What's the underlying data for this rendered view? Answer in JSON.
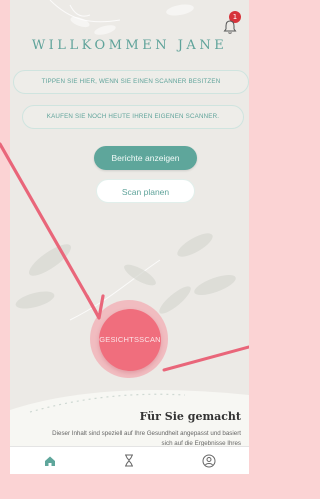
{
  "header": {
    "title": "WILLKOMMEN JANE",
    "notification_count": "1"
  },
  "prompts": {
    "scanner_owner": "TIPPEN SIE HIER, WENN SIE EINEN SCANNER BESITZEN",
    "buy_scanner": "KAUFEN SIE NOCH HEUTE IHREN EIGENEN SCANNER."
  },
  "actions": {
    "reports_label": "Berichte anzeigen",
    "plan_scan_label": "Scan planen",
    "face_scan_label": "GESICHTSSCAN"
  },
  "promo": {
    "title": "Für Sie gemacht",
    "text": "Dieser Inhalt sind speziell auf Ihre Gesundheit angepasst und basiert sich auf die Ergebnisse Ihres"
  },
  "tabs": [
    {
      "icon": "home-icon"
    },
    {
      "icon": "hourglass-icon"
    },
    {
      "icon": "profile-icon"
    }
  ],
  "colors": {
    "accent": "#5ea69b",
    "scan": "#f06e7d",
    "background": "#eceae6",
    "outer": "#fbd3d4",
    "arrow": "#e9667a"
  }
}
